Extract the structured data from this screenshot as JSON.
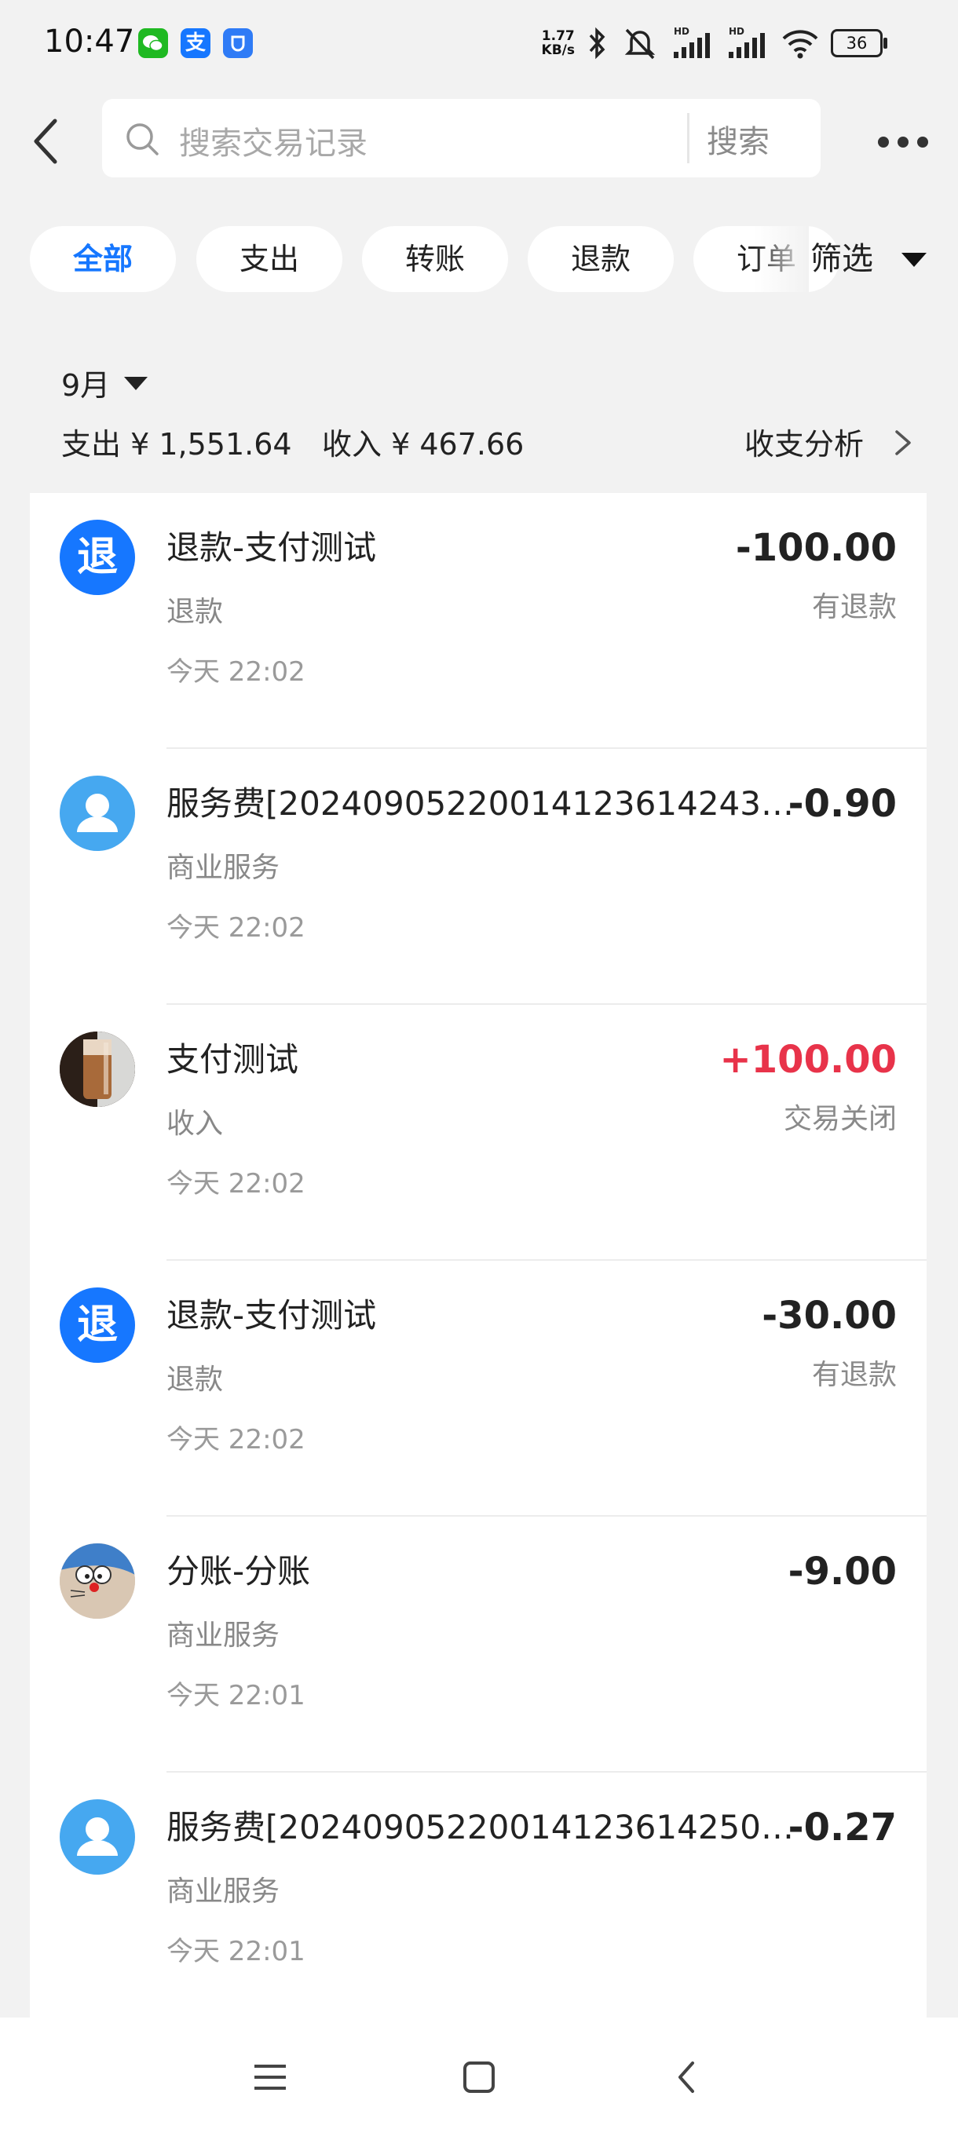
{
  "status_bar": {
    "time": "10:47",
    "apps": [
      "wechat-icon",
      "alipay-icon",
      "app-shield-icon"
    ],
    "alipay_char": "支",
    "net_speed_top": "1.77",
    "net_speed_bottom": "KB/s",
    "battery": "36"
  },
  "header": {
    "search_placeholder": "搜索交易记录",
    "search_button": "搜索"
  },
  "filters": {
    "chips": [
      "全部",
      "支出",
      "转账",
      "退款",
      "订单"
    ],
    "active": "全部",
    "filter_label": "筛选"
  },
  "summary": {
    "month": "9月",
    "expense": "支出 ¥ 1,551.64",
    "income": "收入 ¥ 467.66",
    "analysis_label": "收支分析"
  },
  "transactions": [
    {
      "avatar": "退",
      "avatar_type": "refund-icon",
      "title": "退款-支付测试",
      "category": "退款",
      "time": "今天 22:02",
      "amount": "-100.00",
      "status": "有退款"
    },
    {
      "avatar": "",
      "avatar_type": "user-icon",
      "title": "服务费[2024090522001412361424397...",
      "category": "商业服务",
      "time": "今天 22:02",
      "amount": "-0.90",
      "status": ""
    },
    {
      "avatar": "",
      "avatar_type": "photo-avatar-cup",
      "title": "支付测试",
      "category": "收入",
      "time": "今天 22:02",
      "amount": "+100.00",
      "status": "交易关闭"
    },
    {
      "avatar": "退",
      "avatar_type": "refund-icon",
      "title": "退款-支付测试",
      "category": "退款",
      "time": "今天 22:02",
      "amount": "-30.00",
      "status": "有退款"
    },
    {
      "avatar": "",
      "avatar_type": "photo-avatar-cartoon",
      "title": "分账-分账",
      "category": "商业服务",
      "time": "今天 22:01",
      "amount": "-9.00",
      "status": ""
    },
    {
      "avatar": "",
      "avatar_type": "user-icon",
      "title": "服务费[2024090522001412361425068...",
      "category": "商业服务",
      "time": "今天 22:01",
      "amount": "-0.27",
      "status": ""
    }
  ],
  "colors": {
    "accent": "#1677ff",
    "income": "#e8334a",
    "background": "#f2f2f2"
  }
}
